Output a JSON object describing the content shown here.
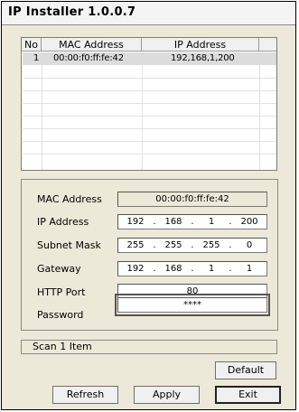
{
  "window": {
    "title": "IP Installer 1.0.0.7"
  },
  "device_list": {
    "columns": [
      "No",
      "MAC Address",
      "IP Address"
    ],
    "rows": [
      {
        "no": "1",
        "mac": "00:00:f0:ff:fe:42",
        "ip": "192,168,1,200"
      }
    ]
  },
  "settings": {
    "mac_label": "MAC Address",
    "mac_value": "00:00:f0:ff:fe:42",
    "ip_label": "IP Address",
    "ip_value": [
      "192",
      "168",
      "1",
      "200"
    ],
    "subnet_label": "Subnet Mask",
    "subnet_value": [
      "255",
      "255",
      "255",
      "0"
    ],
    "gateway_label": "Gateway",
    "gateway_value": [
      "192",
      "168",
      "1",
      "1"
    ],
    "separator": ".",
    "http_port_label": "HTTP Port",
    "http_port_value": "80",
    "password_label": "Password",
    "password_value": "****"
  },
  "status": {
    "text": "Scan 1 Item"
  },
  "buttons": {
    "default": "Default",
    "refresh": "Refresh",
    "apply": "Apply",
    "exit": "Exit"
  }
}
